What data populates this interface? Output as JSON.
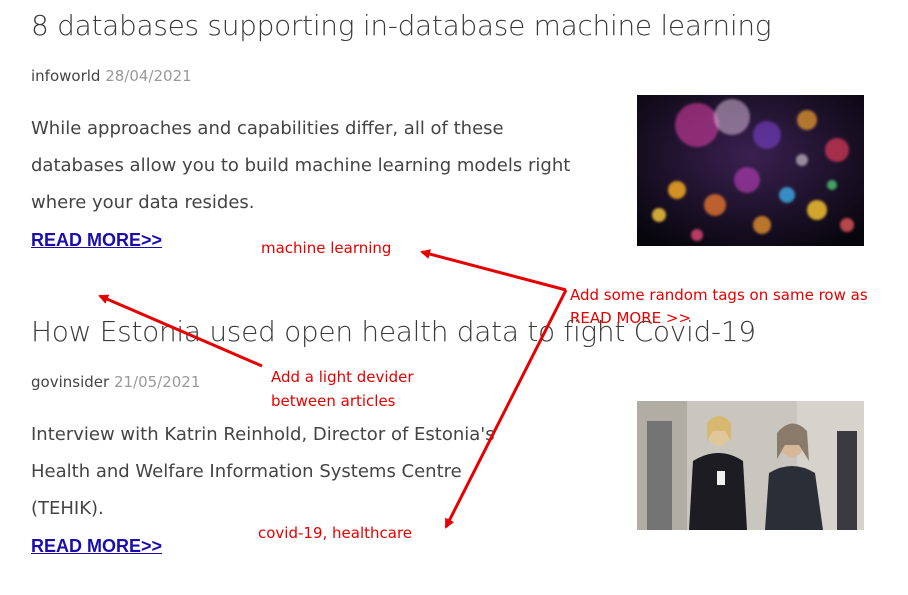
{
  "articles": [
    {
      "title": "8 databases supporting in-database machine learning",
      "source": "infoworld",
      "date": "28/04/2021",
      "description": "While approaches and capabilities differ, all of these databases allow you to build machine learning models right where your data resides.",
      "read_more": "READ MORE>>"
    },
    {
      "title": "How Estonia used open health data to fight Covid-19",
      "source": "govinsider",
      "date": "21/05/2021",
      "description": "Interview with Katrin Reinhold, Director of Estonia's Health and Welfare Information Systems Centre (TEHIK).",
      "read_more": "READ MORE>>"
    }
  ],
  "annotations": {
    "tag_1": "machine learning",
    "tag_2": "covid-19, healthcare",
    "tags_note_line1": "Add some random tags on same row as",
    "tags_note_line2": "READ MORE >>",
    "divider_note_line1": "Add a light devider",
    "divider_note_line2": "between articles"
  },
  "colors": {
    "annotation": "#e60000",
    "link": "#1a0dab"
  }
}
